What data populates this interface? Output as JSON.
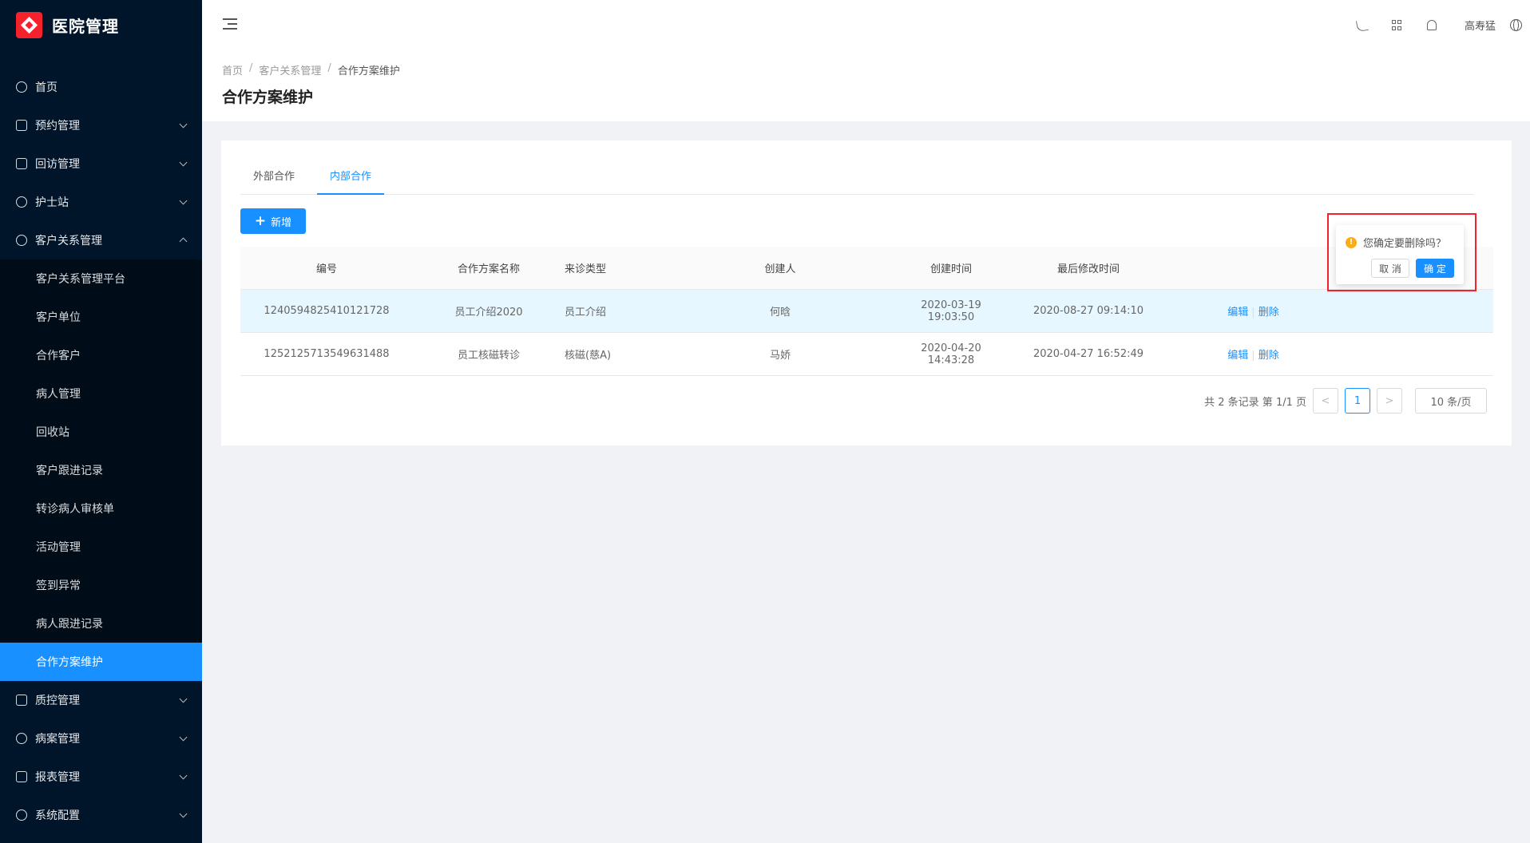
{
  "app": {
    "title": "医院管理",
    "brand_color": "#1890ff",
    "accent_red": "#f5222d"
  },
  "sidebar": {
    "top_items": [
      {
        "label": "首页",
        "icon": "home-icon"
      },
      {
        "label": "预约管理",
        "icon": "edit-icon"
      },
      {
        "label": "回访管理",
        "icon": "lock-icon"
      },
      {
        "label": "护士站",
        "icon": "user-icon"
      },
      {
        "label": "客户关系管理",
        "icon": "user-icon"
      }
    ],
    "sub_items": [
      {
        "label": "客户关系管理平台"
      },
      {
        "label": "客户单位"
      },
      {
        "label": "合作客户"
      },
      {
        "label": "病人管理"
      },
      {
        "label": "回收站"
      },
      {
        "label": "客户跟进记录"
      },
      {
        "label": "转诊病人审核单"
      },
      {
        "label": "活动管理"
      },
      {
        "label": "签到异常"
      },
      {
        "label": "病人跟进记录"
      },
      {
        "label": "合作方案维护"
      }
    ],
    "bottom_items": [
      {
        "label": "质控管理",
        "icon": "table-icon"
      },
      {
        "label": "病案管理",
        "icon": "user-icon"
      },
      {
        "label": "报表管理",
        "icon": "edit-icon"
      },
      {
        "label": "系统配置",
        "icon": "dashboard-icon"
      }
    ]
  },
  "header": {
    "user": "高寿猛"
  },
  "breadcrumb": {
    "items": [
      "首页",
      "客户关系管理",
      "合作方案维护"
    ]
  },
  "page": {
    "title": "合作方案维护"
  },
  "tabs": [
    {
      "label": "外部合作"
    },
    {
      "label": "内部合作"
    }
  ],
  "toolbar": {
    "add_label": "新增"
  },
  "table": {
    "columns": [
      "编号",
      "合作方案名称",
      "来诊类型",
      "创建人",
      "创建时间",
      "最后修改时间",
      ""
    ],
    "rows": [
      {
        "id": "1240594825410121728",
        "name": "员工介绍2020",
        "type": "员工介绍",
        "creator": "何晗",
        "created": "2020-03-19 19:03:50",
        "modified": "2020-08-27 09:14:10",
        "edit": "编辑",
        "delete": "删除"
      },
      {
        "id": "1252125713549631488",
        "name": "员工核磁转诊",
        "type": "核磁(慈A)",
        "creator": "马娇",
        "created": "2020-04-20 14:43:28",
        "modified": "2020-04-27 16:52:49",
        "edit": "编辑",
        "delete": "删除"
      }
    ]
  },
  "pagination": {
    "summary": "共 2 条记录 第 1/1 页",
    "current": "1",
    "prev": "<",
    "next": ">",
    "page_size": "10 条/页"
  },
  "popconfirm": {
    "message": "您确定要删除吗？",
    "cancel": "取 消",
    "ok": "确 定",
    "warn_glyph": "!"
  }
}
